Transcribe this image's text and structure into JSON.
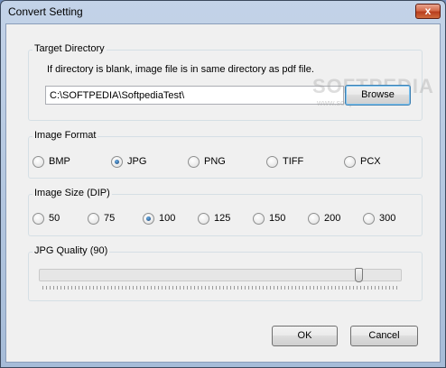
{
  "window": {
    "title": "Convert Setting",
    "close_glyph": "x"
  },
  "target_directory": {
    "label": "Target Directory",
    "hint": "If directory is blank, image file is in same directory as pdf file.",
    "value": "C:\\SOFTPEDIA\\SoftpediaTest\\",
    "browse_label": "Browse"
  },
  "image_format": {
    "label": "Image Format",
    "options": [
      "BMP",
      "JPG",
      "PNG",
      "TIFF",
      "PCX"
    ],
    "selected": "JPG"
  },
  "image_size": {
    "label": "Image Size (DIP)",
    "options": [
      "50",
      "75",
      "100",
      "125",
      "150",
      "200",
      "300"
    ],
    "selected": "100"
  },
  "jpg_quality": {
    "label": "JPG Quality (90)",
    "value": 90
  },
  "watermark": {
    "brand": "SOFTPEDIA",
    "url": "www.softpedia.com"
  },
  "buttons": {
    "ok": "OK",
    "cancel": "Cancel"
  }
}
